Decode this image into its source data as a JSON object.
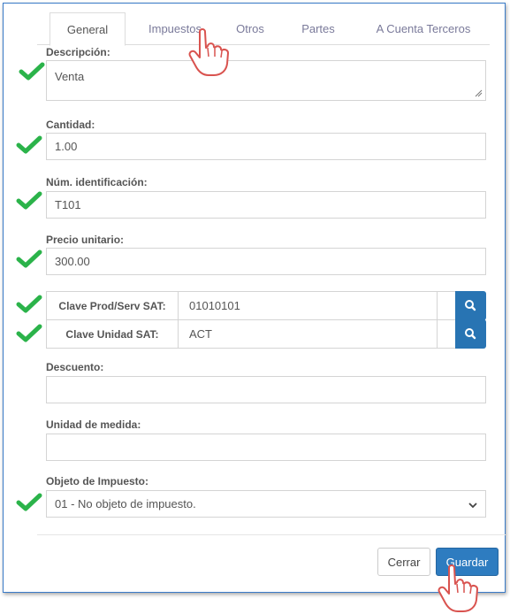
{
  "tabs": [
    "General",
    "Impuestos",
    "Otros",
    "Partes",
    "A Cuenta Terceros"
  ],
  "form": {
    "descripcion": {
      "label": "Descripción:",
      "value": "Venta"
    },
    "cantidad": {
      "label": "Cantidad:",
      "value": "1.00"
    },
    "num_identificacion": {
      "label": "Núm. identificación:",
      "value": "T101"
    },
    "precio_unitario": {
      "label": "Precio unitario:",
      "value": "300.00"
    },
    "clave_prod_serv": {
      "label": "Clave Prod/Serv SAT:",
      "value": "01010101"
    },
    "clave_unidad": {
      "label": "Clave Unidad SAT:",
      "value": "ACT"
    },
    "descuento": {
      "label": "Descuento:",
      "value": ""
    },
    "unidad_medida": {
      "label": "Unidad de medida:",
      "value": ""
    },
    "objeto_impuesto": {
      "label": "Objeto de Impuesto:",
      "value": "01 - No objeto de impuesto."
    }
  },
  "buttons": {
    "cerrar": "Cerrar",
    "guardar": "Guardar"
  },
  "colors": {
    "primary": "#2e7cc0",
    "check": "#2bb34a",
    "hand": "#d9534f"
  },
  "icons": {
    "check": "checkmark-icon",
    "search": "search-icon",
    "chevron": "chevron-down-icon",
    "pointer": "hand-pointer-icon"
  }
}
